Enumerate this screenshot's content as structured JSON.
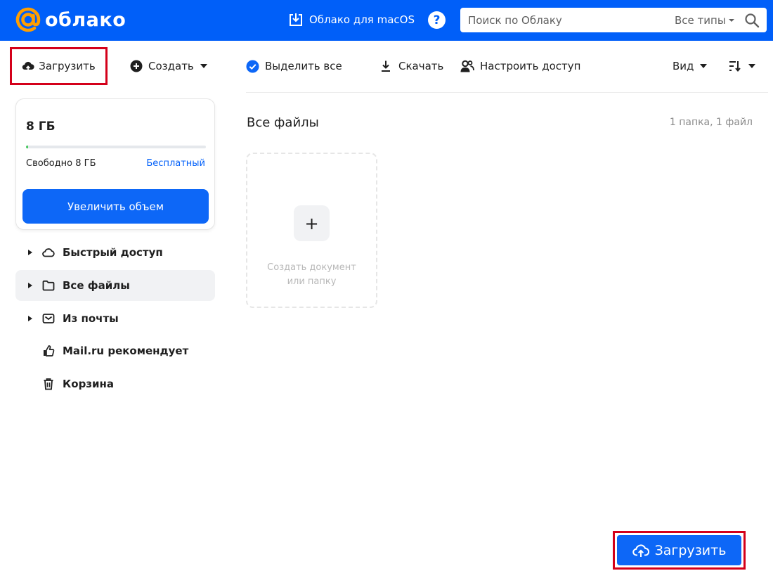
{
  "header": {
    "logo_text": "облако",
    "macos_link": "Облако для macOS",
    "help_label": "?",
    "search": {
      "placeholder": "Поиск по Облаку",
      "value": "",
      "type_filter": "Все типы"
    }
  },
  "toolbar": {
    "upload": "Загрузить",
    "create": "Создать",
    "select_all": "Выделить все",
    "download": "Скачать",
    "access": "Настроить доступ",
    "view": "Вид"
  },
  "storage": {
    "size": "8 ГБ",
    "free": "Свободно 8 ГБ",
    "plan": "Бесплатный",
    "used_fraction": 0.01,
    "increase_button": "Увеличить объем"
  },
  "sidebar": {
    "items": [
      {
        "label": "Быстрый доступ",
        "icon": "cloud-icon",
        "expandable": true,
        "active": false
      },
      {
        "label": "Все файлы",
        "icon": "folder-icon",
        "expandable": true,
        "active": true
      },
      {
        "label": "Из почты",
        "icon": "mail-icon",
        "expandable": true,
        "active": false
      },
      {
        "label": "Mail.ru рекомендует",
        "icon": "thumbs-up-icon",
        "expandable": false,
        "active": false
      },
      {
        "label": "Корзина",
        "icon": "trash-icon",
        "expandable": false,
        "active": false
      }
    ]
  },
  "main": {
    "title": "Все файлы",
    "count": "1 папка, 1 файл",
    "create_tile": {
      "plus": "+",
      "line1": "Создать документ",
      "line2": "или папку"
    }
  },
  "fab": {
    "label": "Загрузить"
  },
  "colors": {
    "brand": "#005ff9",
    "button": "#0d67f7",
    "highlight": "#d4001a",
    "storage_fill": "#4cc964",
    "logo_orange": "#ff9e00"
  }
}
